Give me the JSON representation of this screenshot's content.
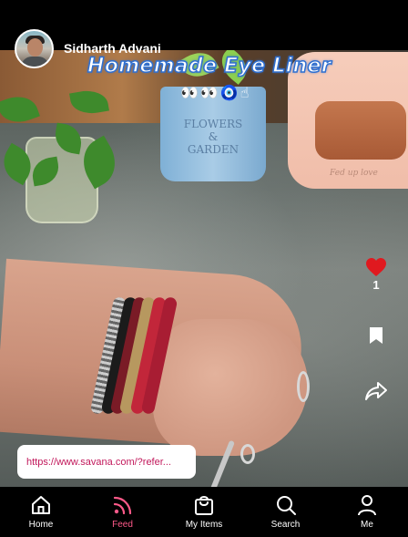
{
  "user": {
    "name": "Sidharth Advani"
  },
  "post": {
    "title": "Homemade Eye Liner",
    "emoji": "👀👀🧿☝",
    "pot_text": "FLOWERS\n&\nGARDEN",
    "toaster_brand": "Fed up love",
    "like_count": "1",
    "link": "https://www.savana.com/?refer..."
  },
  "icons": {
    "like": "heart-icon",
    "save": "bookmark-icon",
    "share": "share-icon"
  },
  "colors": {
    "like": "#e0191f",
    "active_nav": "#ff5a8a",
    "link_text": "#c2185b",
    "title_stroke": "#2f6fd0"
  },
  "nav": {
    "items": [
      {
        "label": "Home",
        "icon": "home-icon",
        "active": false
      },
      {
        "label": "Feed",
        "icon": "feed-icon",
        "active": true
      },
      {
        "label": "My Items",
        "icon": "shopping-bag-icon",
        "active": false
      },
      {
        "label": "Search",
        "icon": "search-icon",
        "active": false
      },
      {
        "label": "Me",
        "icon": "profile-icon",
        "active": false
      }
    ]
  }
}
